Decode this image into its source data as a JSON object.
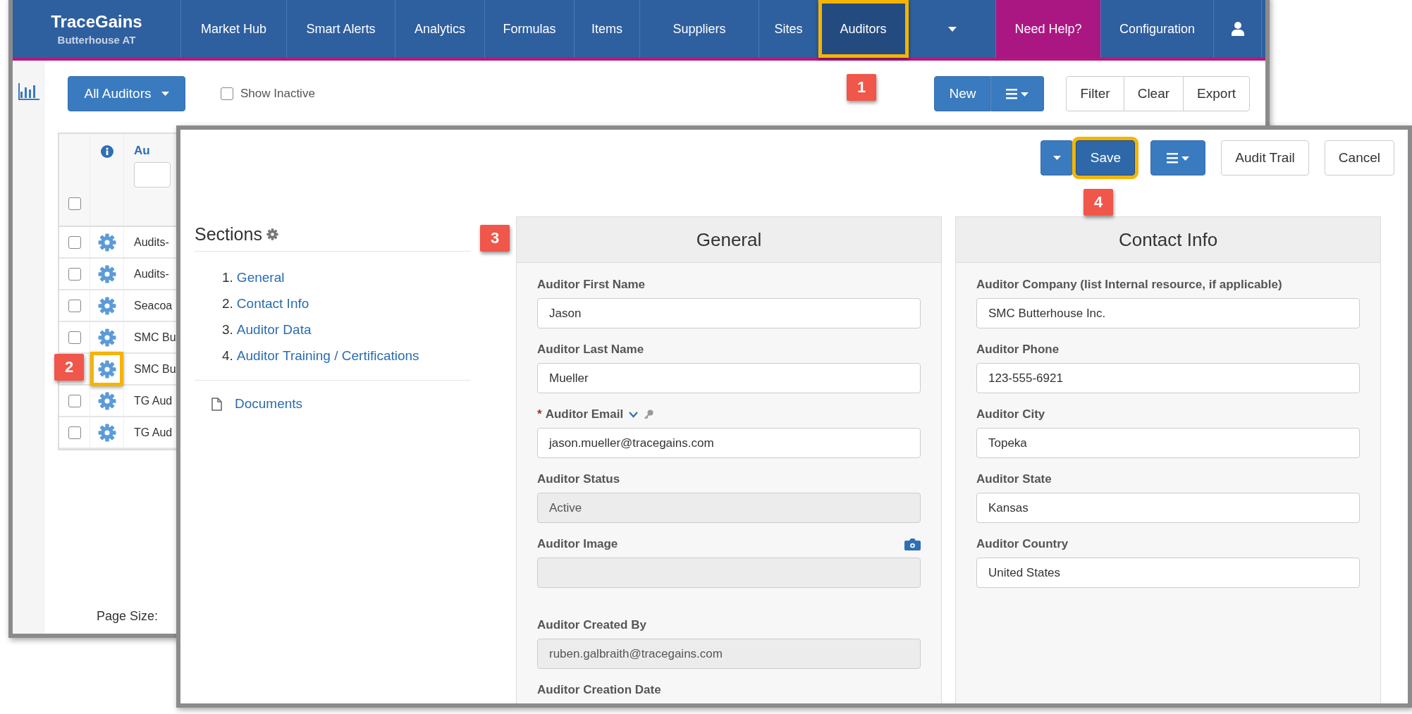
{
  "app": {
    "brand": "TraceGains",
    "subtitle": "Butterhouse AT"
  },
  "nav": [
    {
      "kind": "link",
      "label": "Market Hub",
      "selected": false,
      "highlighted": false
    },
    {
      "kind": "link",
      "label": "Smart Alerts",
      "selected": false,
      "highlighted": false
    },
    {
      "kind": "link",
      "label": "Analytics",
      "selected": false,
      "highlighted": false
    },
    {
      "kind": "link",
      "label": "Formulas",
      "selected": false,
      "highlighted": false
    },
    {
      "kind": "link",
      "label": "Items",
      "selected": false,
      "highlighted": false
    },
    {
      "kind": "link",
      "label": "Suppliers",
      "selected": false,
      "highlighted": false
    },
    {
      "kind": "link",
      "label": "Sites",
      "selected": false,
      "highlighted": false
    },
    {
      "kind": "link",
      "label": "Auditors",
      "selected": true,
      "highlighted": true
    },
    {
      "kind": "menu",
      "selected": false,
      "highlighted": false
    },
    {
      "kind": "help",
      "label": "Need Help?",
      "selected": false,
      "highlighted": false
    },
    {
      "kind": "link",
      "label": "Configuration",
      "selected": false,
      "highlighted": false
    },
    {
      "kind": "user",
      "selected": false,
      "highlighted": false
    }
  ],
  "toolbar": {
    "view_button": "All Auditors",
    "show_inactive": {
      "label": "Show Inactive",
      "checked": false
    },
    "new_button": "New",
    "actions": [
      "Filter",
      "Clear",
      "Export"
    ]
  },
  "table": {
    "column_3": "Au",
    "select_all": false,
    "rows": [
      {
        "checked": false,
        "highlighted": false,
        "name": "Audits-"
      },
      {
        "checked": false,
        "highlighted": false,
        "name": "Audits-"
      },
      {
        "checked": false,
        "highlighted": false,
        "name": "Seacoa"
      },
      {
        "checked": false,
        "highlighted": false,
        "name": "SMC Bu"
      },
      {
        "highlighted": true,
        "name": "SMC Bu"
      },
      {
        "checked": false,
        "highlighted": false,
        "name": "TG Aud"
      },
      {
        "checked": false,
        "highlighted": false,
        "name": "TG Aud"
      }
    ]
  },
  "page_size_label": "Page Size:",
  "editor": {
    "save_button": {
      "label": "Save",
      "highlighted": true
    },
    "audit_trail_button": "Audit Trail",
    "cancel_button": "Cancel",
    "sections": {
      "title": "Sections",
      "items": [
        {
          "number": "1.",
          "label": "General"
        },
        {
          "number": "2.",
          "label": "Contact Info"
        },
        {
          "number": "3.",
          "label": "Auditor Data"
        },
        {
          "number": "4.",
          "label": "Auditor Training / Certifications"
        }
      ],
      "documents": "Documents"
    },
    "panels": [
      {
        "title": "General",
        "fields": [
          {
            "kind": "text",
            "label": "Auditor First Name",
            "value": "Jason",
            "disabled": false
          },
          {
            "kind": "text",
            "label": "Auditor Last Name",
            "value": "Mueller",
            "disabled": false
          },
          {
            "kind": "lookup",
            "required_mark": "*",
            "label": "Auditor Email",
            "value": "jason.mueller@tracegains.com",
            "disabled": false
          },
          {
            "kind": "text",
            "label": "Auditor Status",
            "value": "Active",
            "disabled": true
          },
          {
            "kind": "image",
            "label": "Auditor Image",
            "disabled": true
          },
          {
            "kind": "text",
            "label": "Auditor Created By",
            "value": "ruben.galbraith@tracegains.com",
            "disabled": true
          },
          {
            "kind": "text",
            "label": "Auditor Creation Date"
          }
        ]
      },
      {
        "title": "Contact Info",
        "fields": [
          {
            "kind": "text",
            "label": "Auditor Company (list Internal resource, if applicable)",
            "value": "SMC Butterhouse Inc.",
            "disabled": false
          },
          {
            "kind": "text",
            "label": "Auditor Phone",
            "value": "123-555-6921",
            "disabled": false
          },
          {
            "kind": "text",
            "label": "Auditor City",
            "value": "Topeka",
            "disabled": false
          },
          {
            "kind": "text",
            "label": "Auditor State",
            "value": "Kansas",
            "disabled": false
          },
          {
            "kind": "text",
            "label": "Auditor Country",
            "value": "United States",
            "disabled": false
          }
        ]
      }
    ]
  },
  "callouts": [
    {
      "number": "1"
    },
    {
      "number": "2"
    },
    {
      "number": "3"
    },
    {
      "number": "4"
    }
  ]
}
